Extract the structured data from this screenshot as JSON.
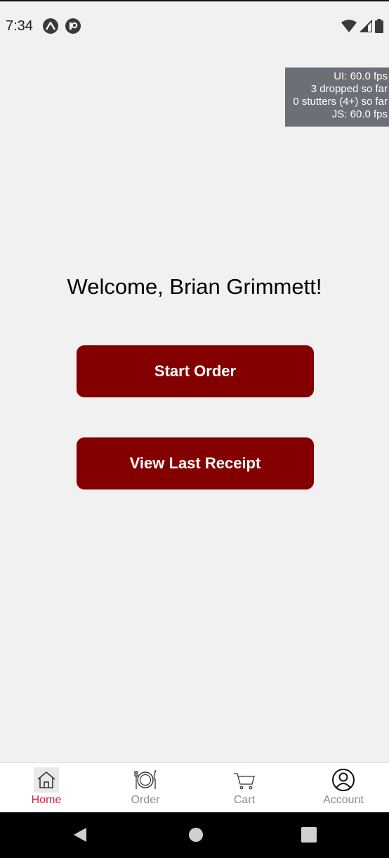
{
  "status_bar": {
    "time": "7:34"
  },
  "perf_monitor": {
    "ui_fps": "UI: 60.0 fps",
    "dropped": "3 dropped so far",
    "stutters": "0 stutters (4+) so far",
    "js_fps": "JS: 60.0 fps"
  },
  "main": {
    "welcome": "Welcome, Brian Grimmett!",
    "start_order_label": "Start Order",
    "view_receipt_label": "View Last Receipt",
    "accent_color": "#840000"
  },
  "tabs": [
    {
      "label": "Home",
      "icon": "home-icon",
      "active": true
    },
    {
      "label": "Order",
      "icon": "plate-cutlery-icon",
      "active": false
    },
    {
      "label": "Cart",
      "icon": "cart-icon",
      "active": false
    },
    {
      "label": "Account",
      "icon": "user-circle-icon",
      "active": false
    }
  ],
  "colors": {
    "active_tab": "#e31837",
    "inactive_tab": "#8a8f96",
    "background": "#f2f1f2"
  }
}
